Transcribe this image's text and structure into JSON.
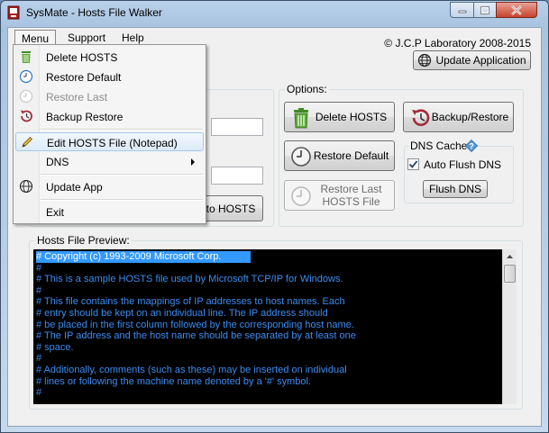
{
  "window": {
    "title": "SysMate - Hosts File Walker"
  },
  "menubar": {
    "items": [
      "Menu",
      "Support",
      "Help"
    ]
  },
  "copyright": "© J.C.P Laboratory 2008-2015",
  "update_button": "Update Application",
  "left_panel": {
    "add_button_label": "d to HOSTS"
  },
  "options": {
    "label": "Options:",
    "delete_hosts": "Delete HOSTS",
    "backup_restore": "Backup/Restore",
    "restore_default": "Restore Default",
    "restore_last": "Restore Last HOSTS File",
    "dns_cache": {
      "label": "DNS Cache",
      "auto_flush_label": "Auto Flush DNS",
      "auto_flush_checked": true,
      "flush_button": "Flush DNS"
    }
  },
  "preview": {
    "label": "Hosts File Preview:",
    "lines": [
      "# Copyright (c) 1993-2009 Microsoft Corp.",
      "#",
      "# This is a sample HOSTS file used by Microsoft TCP/IP for Windows.",
      "#",
      "# This file contains the mappings of IP addresses to host names. Each",
      "# entry should be kept on an individual line. The IP address should",
      "# be placed in the first column followed by the corresponding host name.",
      "# The IP address and the host name should be separated by at least one",
      "# space.",
      "#",
      "# Additionally, comments (such as these) may be inserted on individual",
      "# lines or following the machine name denoted by a '#' symbol.",
      "#"
    ]
  },
  "menu_dropdown": {
    "items": [
      {
        "label": "Delete HOSTS",
        "icon": "trash-icon"
      },
      {
        "label": "Restore Default",
        "icon": "clock-icon"
      },
      {
        "label": "Restore Last",
        "icon": "clock-faded-icon",
        "disabled": true
      },
      {
        "label": "Backup Restore",
        "icon": "backup-restore-icon"
      },
      {
        "label": "Edit HOSTS File (Notepad)",
        "icon": "pencil-icon",
        "highlighted": true
      },
      {
        "label": "DNS",
        "submenu": true
      },
      {
        "label": "Update App",
        "icon": "globe-icon"
      },
      {
        "label": "Exit"
      }
    ]
  },
  "colors": {
    "accent": "#3399ff",
    "terminal_text": "#3c8cf0",
    "terminal_bg": "#000000",
    "trash_green": "#4e9a2b",
    "backup_red": "#a32b3a"
  }
}
